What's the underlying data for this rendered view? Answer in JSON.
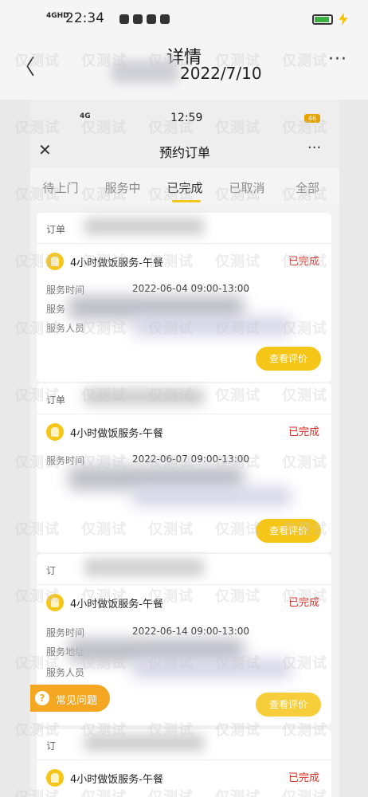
{
  "outer_status": {
    "signal": "4GHD",
    "time": "22:34",
    "battery": ""
  },
  "outer_header": {
    "back": "〈",
    "title": "详情",
    "more": "···",
    "date_prefix": "",
    "date": "2022/7/10"
  },
  "inner_status": {
    "signal": "4G",
    "time": "12:59",
    "battery": "46"
  },
  "inner_nav": {
    "close": "✕",
    "title": "预约订单",
    "more": "···"
  },
  "tabs": [
    "待上门",
    "服务中",
    "已完成",
    "已取消",
    "全部"
  ],
  "cards": [
    {
      "order": "订单",
      "service": "4小时做饭服务-午餐",
      "status": "已完成",
      "time_label": "服务时间",
      "time_value": "2022-06-04 09:00-13:00",
      "addr_label": "服务",
      "person_label": "服务人员",
      "button": "查看评价"
    },
    {
      "order": "订单",
      "service": "4小时做饭服务-午餐",
      "status": "已完成",
      "time_label": "服务时间",
      "time_value": "2022-06-07 09:00-13:00",
      "addr_label": "",
      "person_label": "",
      "button": "查看评价"
    },
    {
      "order": "订",
      "service": "4小时做饭服务-午餐",
      "status": "已完成",
      "time_label": "服务时间",
      "time_value": "2022-06-14 09:00-13:00",
      "addr_label": "服务地址",
      "person_label": "服务人员",
      "button": "查看评价"
    },
    {
      "order": "订",
      "service": "4小时做饭服务-午餐",
      "status": "已完成",
      "time_label": "",
      "time_value": "",
      "addr_label": "",
      "person_label": "",
      "button": ""
    }
  ],
  "faq": {
    "icon": "?",
    "label": "常见问题"
  },
  "watermark": "仅测试",
  "colors": {
    "accent": "#f5c518",
    "status_done": "#d93025",
    "faq": "#f5a623"
  }
}
